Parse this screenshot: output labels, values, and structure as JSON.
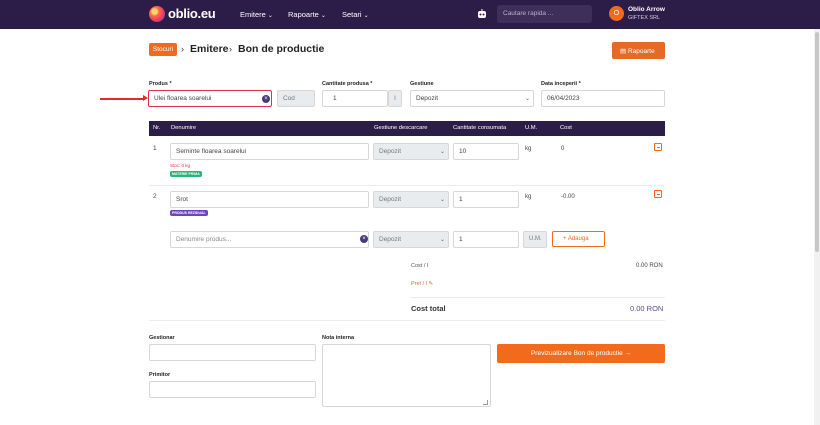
{
  "topbar": {
    "logo_text": "oblio.eu",
    "nav": [
      {
        "label": "Emitere"
      },
      {
        "label": "Rapoarte"
      },
      {
        "label": "Setari"
      }
    ],
    "search_placeholder": "Cautare rapida ...",
    "avatar_initial": "O",
    "user_name": "Oblio Arrow",
    "user_company": "GIFTEX SRL"
  },
  "breadcrumb": {
    "section_button": "Stocuri",
    "level1": "Emitere",
    "level2": "Bon de productie",
    "separator": "›"
  },
  "rapoarte_button": "Rapoarte",
  "form": {
    "produs_label": "Produs *",
    "produs_value": "Ulei floarea soarelui",
    "cod_placeholder": "Cod",
    "cantitate_label": "Cantitate produsa *",
    "cantitate_value": "1",
    "cantitate_unit": "l",
    "gestiune_label": "Gestiune",
    "gestiune_value": "Depozit",
    "data_label": "Data inceperii *",
    "data_value": "06/04/2023"
  },
  "table": {
    "headers": [
      "Nr.",
      "Denumire",
      "Gestiune descarcare",
      "Cantitate consumata",
      "U.M.",
      "Cost"
    ],
    "rows": [
      {
        "nr": "1",
        "denumire": "Seminte floarea soarelui",
        "stock": "Stoc: 0 kg",
        "tag": "MATERIE PRIMA",
        "tag_color": "#2db37a",
        "gestiune": "Depozit",
        "cantitate": "10",
        "um": "kg",
        "cost": "0"
      },
      {
        "nr": "2",
        "denumire": "Srot",
        "stock": "",
        "tag": "PRODUS REZIDUAL",
        "tag_color": "#6f42c1",
        "gestiune": "Depozit",
        "cantitate": "1",
        "um": "kg",
        "cost": "-0.00"
      }
    ],
    "new_row": {
      "denumire_placeholder": "Denumire produs...",
      "gestiune": "Depozit",
      "cantitate": "1",
      "um_placeholder": "U.M.",
      "add_label": "+ Adauga"
    }
  },
  "summary": {
    "cost_label": "Cost / l",
    "cost_value": "0.00 RON",
    "pret_label": "Pret / l",
    "total_label": "Cost total",
    "total_value": "0.00 RON"
  },
  "bottom": {
    "gestionar_label": "Gestionar",
    "primitor_label": "Primitor",
    "nota_label": "Nota interna",
    "preview_button": "Previzualizare Bon de productie →"
  },
  "colors": {
    "topbar": "#2c1c48",
    "accent": "#f26b1d",
    "focus_red": "#e0324b"
  }
}
